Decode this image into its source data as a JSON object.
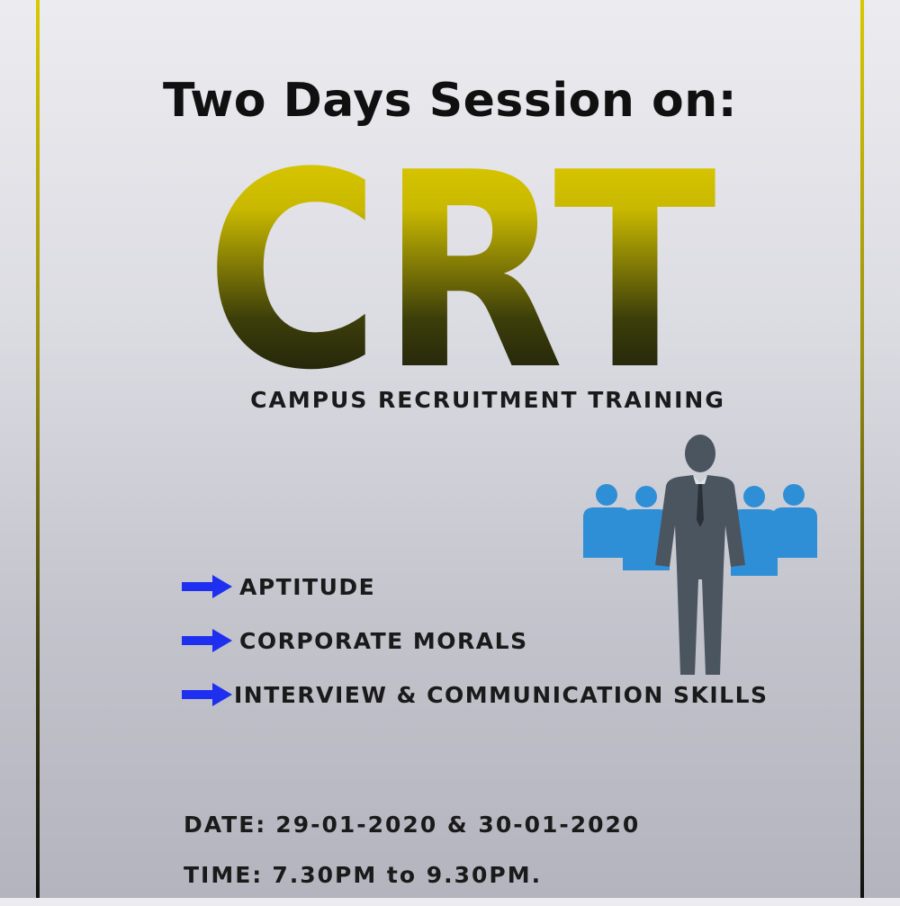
{
  "poster": {
    "headline": "Two Days Session on:",
    "logo_text": "CRT",
    "subtitle": "CAMPUS RECRUITMENT TRAINING",
    "topics": [
      {
        "label": "APTITUDE",
        "icon": "blue-arrow-icon"
      },
      {
        "label": "CORPORATE MORALS",
        "icon": "blue-arrow-icon"
      },
      {
        "label": "INTERVIEW & COMMUNICATION SKILLS",
        "icon": "blue-arrow-icon"
      }
    ],
    "schedule": {
      "date_label": "DATE:",
      "date_value": "29-01-2020 & 30-01-2020",
      "time_label": "TIME:",
      "time_value": "7.30PM to 9.30PM."
    },
    "illustration": "business-team-icon"
  },
  "colors": {
    "logo_top": "#e6d200",
    "logo_bottom": "#0c0c0c",
    "arrow": "#1f2ff0",
    "people_blue": "#2e8fd6",
    "leader": "#4a5560",
    "frame": "#c8b800",
    "text": "#1a1a1a"
  }
}
